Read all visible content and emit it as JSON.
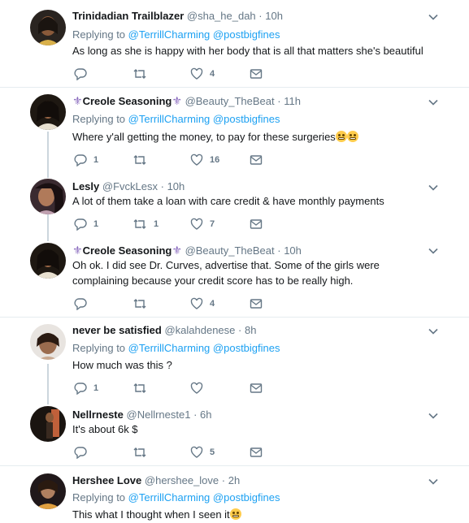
{
  "tweets": [
    {
      "name": "Trinidadian Trailblazer",
      "handle": "@sha_he_dah",
      "time": "10h",
      "replying_prefix": "Replying to",
      "replying_to": [
        "@TerrillCharming",
        "@postbigfines"
      ],
      "text": "As long as she is happy with her body that is all that  matters she's beautiful",
      "replies": "",
      "retweets": "",
      "likes": "4"
    },
    {
      "name": "Creole Seasoning",
      "handle": "@Beauty_TheBeat",
      "time": "11h",
      "replying_prefix": "Replying to",
      "replying_to": [
        "@TerrillCharming",
        "@postbigfines"
      ],
      "text": "Where y'all getting the money, to pay for these surgeries",
      "replies": "1",
      "retweets": "",
      "likes": "16"
    },
    {
      "name": "Lesly",
      "handle": "@FvckLesx",
      "time": "10h",
      "text": "A lot of them take a loan with care credit & have monthly payments",
      "replies": "1",
      "retweets": "1",
      "likes": "7"
    },
    {
      "name": "Creole Seasoning",
      "handle": "@Beauty_TheBeat",
      "time": "10h",
      "text": "Oh ok. I did see Dr. Curves, advertise that. Some of the girls were complaining because your credit score has to be really high.",
      "replies": "",
      "retweets": "",
      "likes": "4"
    },
    {
      "name": "never be satisfied",
      "handle": "@kalahdenese",
      "time": "8h",
      "replying_prefix": "Replying to",
      "replying_to": [
        "@TerrillCharming",
        "@postbigfines"
      ],
      "text": "How much was this ?",
      "replies": "1",
      "retweets": "",
      "likes": ""
    },
    {
      "name": "Nellrneste",
      "handle": "@Nellrneste1",
      "time": "6h",
      "text": "It's about 6k $",
      "replies": "",
      "retweets": "",
      "likes": "5"
    },
    {
      "name": "Hershee Love",
      "handle": "@hershee_love",
      "time": "2h",
      "replying_prefix": "Replying to",
      "replying_to": [
        "@TerrillCharming",
        "@postbigfines"
      ],
      "text": "This what I thought when I seen it",
      "replies": "",
      "retweets": "",
      "likes": ""
    }
  ],
  "dot": "·",
  "colors": {
    "link": "#1da1f2",
    "muted": "#657786",
    "divider": "#e6ecf0",
    "thread": "#ccd6dd"
  },
  "icons": [
    "reply-icon",
    "retweet-icon",
    "like-icon",
    "message-icon",
    "chevron-down-icon",
    "fleur-de-lis-icon",
    "grimace-emoji",
    "eyes-emoji"
  ]
}
